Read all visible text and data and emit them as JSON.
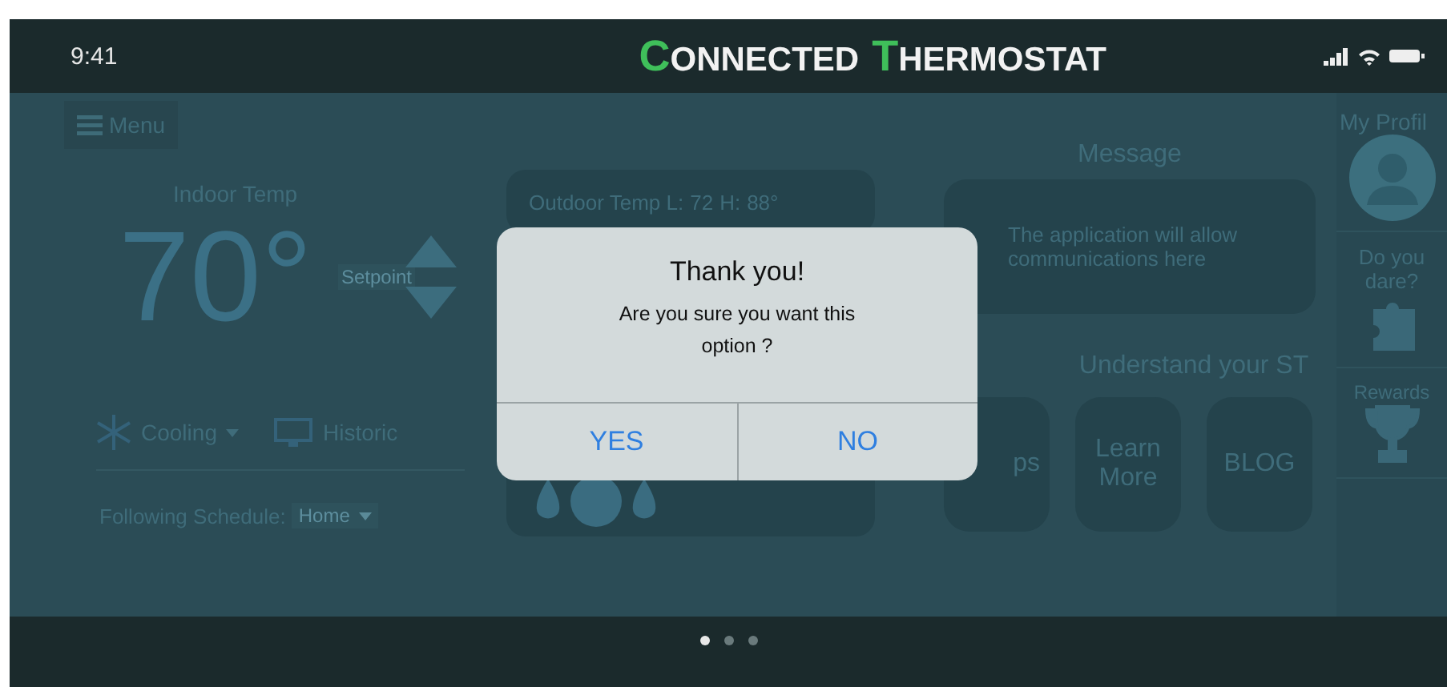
{
  "status_bar": {
    "time": "9:41"
  },
  "header": {
    "title": "CONNECTED THERMOSTAT"
  },
  "menu_button": {
    "label": "Menu"
  },
  "indoor": {
    "label": "Indoor Temp",
    "temperature": "70°",
    "setpoint": "Setpoint"
  },
  "mode": {
    "label": "Cooling"
  },
  "historic": {
    "label": "Historic"
  },
  "schedule": {
    "label": "Following Schedule:",
    "value": "Home"
  },
  "outdoor": {
    "label": "Outdoor Temp L:",
    "low": "72",
    "high_label": "H:",
    "high": "88°"
  },
  "message": {
    "title": "Message",
    "lines": [
      "The application will allow",
      "communications here"
    ]
  },
  "understand": {
    "title": "Understand your ST",
    "buttons": [
      "ps",
      "Learn More",
      "BLOG"
    ]
  },
  "profile": {
    "title": "My Profil"
  },
  "challenge": {
    "title": "Do you dare?"
  },
  "rewards": {
    "title": "Rewards"
  },
  "page_dots": [
    {
      "selected": true
    },
    {
      "selected": false
    },
    {
      "selected": false
    }
  ],
  "dialog": {
    "title": "Thank you!",
    "message": "Are you sure you want this option ?",
    "buttons": [
      "YES",
      "NO"
    ]
  }
}
